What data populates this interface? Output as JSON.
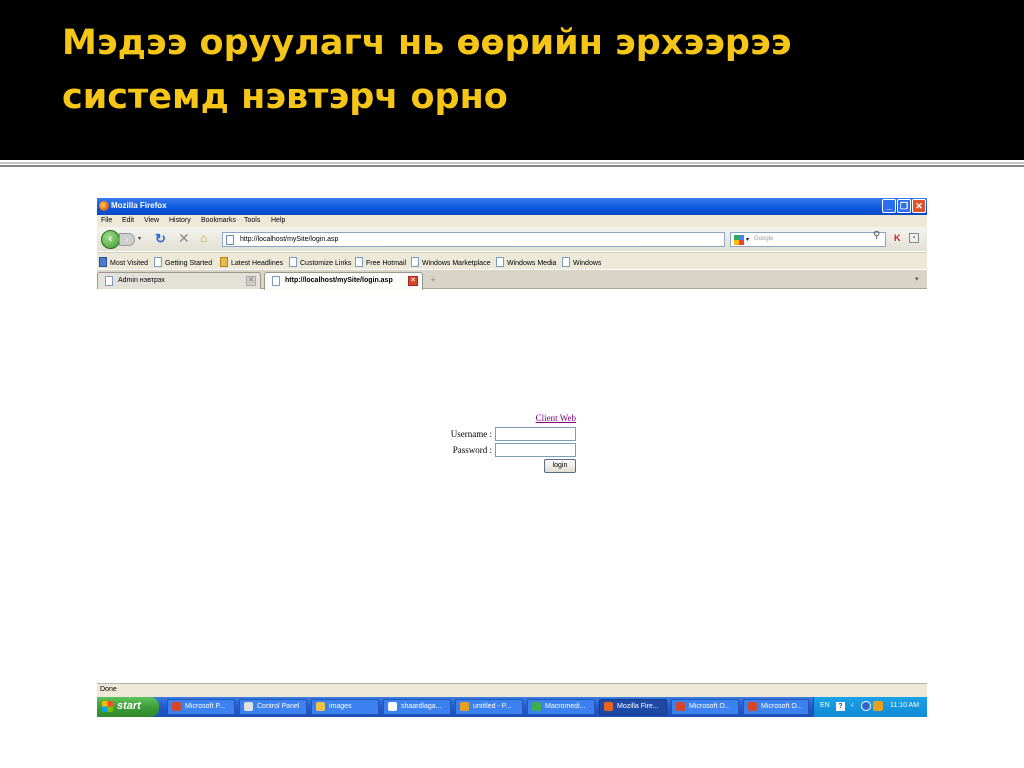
{
  "slide": {
    "title": "Мэдээ оруулагч нь өөрийн эрхээрээ системд нэвтэрч орно"
  },
  "browser": {
    "window_title": "Mozilla Firefox",
    "menu": [
      "File",
      "Edit",
      "View",
      "History",
      "Bookmarks",
      "Tools",
      "Help"
    ],
    "url": "http://localhost/mySite/login.asp",
    "search_placeholder": "Google",
    "bookmarks": [
      "Most Visited",
      "Getting Started",
      "Latest Headlines",
      "Customize Links",
      "Free Hotmail",
      "Windows Marketplace",
      "Windows Media",
      "Windows"
    ],
    "tabs": [
      {
        "label": "Admin нэвтрэх",
        "active": false
      },
      {
        "label": "http://localhost/mySite/login.asp",
        "active": true
      }
    ],
    "status": "Done"
  },
  "login": {
    "link_text": "Client Web",
    "username_label": "Username :",
    "password_label": "Password :",
    "button_label": "login",
    "username_value": "",
    "password_value": ""
  },
  "taskbar": {
    "start_label": "start",
    "items": [
      {
        "label": "Microsoft P...",
        "icon": "powerpoint-icon",
        "icon_color": "#d8462a"
      },
      {
        "label": "Control Panel",
        "icon": "control-panel-icon",
        "icon_color": "#e0e0e0"
      },
      {
        "label": "images",
        "icon": "folder-icon",
        "icon_color": "#f2c24a"
      },
      {
        "label": "shaardlaga...",
        "icon": "document-icon",
        "icon_color": "#ffffff"
      },
      {
        "label": "untitled - P...",
        "icon": "paint-icon",
        "icon_color": "#e8a020"
      },
      {
        "label": "Macromedi...",
        "icon": "macromedia-icon",
        "icon_color": "#3bb04a"
      },
      {
        "label": "Mozilla Fire...",
        "icon": "firefox-icon",
        "icon_color": "#e8651a",
        "active": true
      },
      {
        "label": "Microsoft O...",
        "icon": "office-icon",
        "icon_color": "#d8462a"
      },
      {
        "label": "Microsoft O...",
        "icon": "office-icon",
        "icon_color": "#d8462a"
      }
    ],
    "language": "EN",
    "clock": "11:10 AM"
  },
  "colors": {
    "slide_title": "#f5c518",
    "link_visited": "#800080",
    "titlebar": "#0a55dc"
  }
}
